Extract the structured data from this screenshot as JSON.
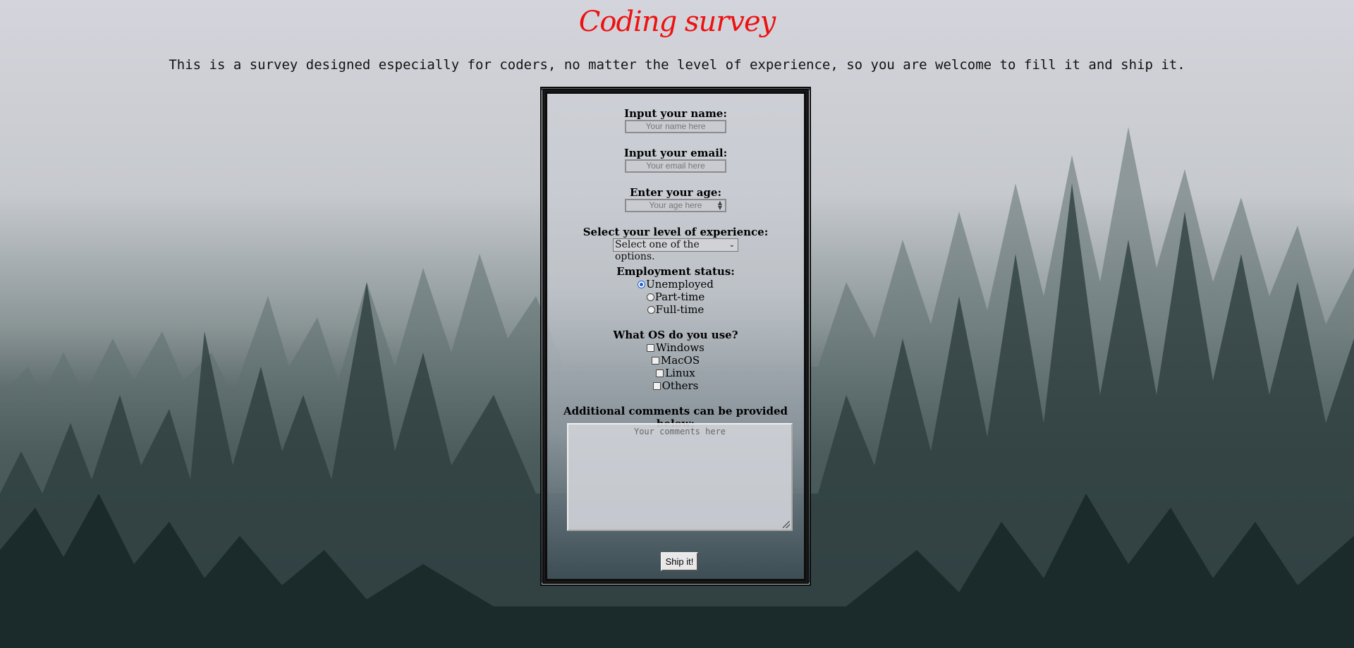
{
  "header": {
    "title": "Coding survey",
    "subtitle": "This is a survey designed especially for coders, no matter the level of experience, so you are welcome to fill it and ship it."
  },
  "form": {
    "name": {
      "label": "Input your name:",
      "placeholder": "Your name here"
    },
    "email": {
      "label": "Input your email:",
      "placeholder": "Your email here"
    },
    "age": {
      "label": "Enter your age:",
      "placeholder": "Your age here"
    },
    "experience": {
      "label": "Select your level of experience:",
      "selected": "Select one of the options."
    },
    "employment": {
      "label": "Employment status:",
      "options": [
        "Unemployed",
        "Part-time",
        "Full-time"
      ],
      "selected": "Unemployed"
    },
    "os": {
      "label": "What OS do you use?",
      "options": [
        "Windows",
        "MacOS",
        "Linux",
        "Others"
      ]
    },
    "comments": {
      "label": "Additional comments can be provided below:",
      "placeholder": "Your comments here"
    },
    "submit_label": "Ship it!"
  },
  "colors": {
    "title": "#ee1111",
    "radio_accent": "#1a5fd1"
  }
}
